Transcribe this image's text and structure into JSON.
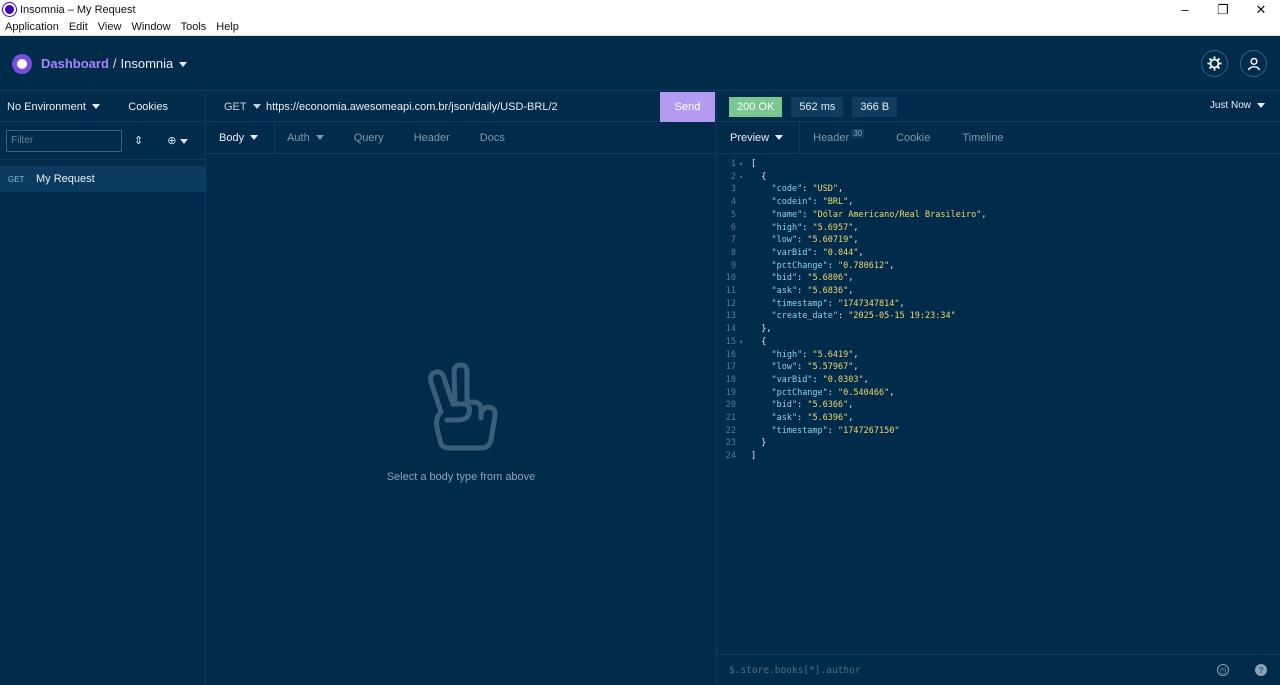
{
  "window": {
    "title": "Insomnia – My Request",
    "min": "–",
    "max": "❐",
    "close": "✕"
  },
  "menu": [
    "Application",
    "Edit",
    "View",
    "Window",
    "Tools",
    "Help"
  ],
  "header": {
    "dashboard": "Dashboard",
    "separator": "/",
    "workspace": "Insomnia",
    "settings_icon": "gear-icon",
    "account_icon": "user-icon"
  },
  "sidebar": {
    "environment": "No Environment",
    "cookies": "Cookies",
    "filter_placeholder": "Filter",
    "requests": [
      {
        "method": "GET",
        "name": "My Request"
      }
    ]
  },
  "request": {
    "method": "GET",
    "url": "https://economia.awesomeapi.com.br/json/daily/USD-BRL/2",
    "send": "Send",
    "tabs": [
      "Body",
      "Auth",
      "Query",
      "Header",
      "Docs"
    ],
    "empty_text": "Select a body type from above"
  },
  "response": {
    "status": "200 OK",
    "time": "562 ms",
    "size": "366 B",
    "when": "Just Now",
    "tabs": {
      "preview": "Preview",
      "header": "Header",
      "header_count": "30",
      "cookie": "Cookie",
      "timeline": "Timeline"
    },
    "status_color": "#7bc792",
    "lines": [
      {
        "n": "1",
        "fold": "▾",
        "indent": "",
        "text": "["
      },
      {
        "n": "2",
        "fold": "▾",
        "indent": "  ",
        "text": "{"
      },
      {
        "n": "3",
        "fold": "",
        "indent": "    ",
        "key": "\"code\"",
        "val": "\"USD\"",
        "end": ","
      },
      {
        "n": "4",
        "fold": "",
        "indent": "    ",
        "key": "\"codein\"",
        "val": "\"BRL\"",
        "end": ","
      },
      {
        "n": "5",
        "fold": "",
        "indent": "    ",
        "key": "\"name\"",
        "val": "\"Dólar Americano/Real Brasileiro\"",
        "end": ","
      },
      {
        "n": "6",
        "fold": "",
        "indent": "    ",
        "key": "\"high\"",
        "val": "\"5.6957\"",
        "end": ","
      },
      {
        "n": "7",
        "fold": "",
        "indent": "    ",
        "key": "\"low\"",
        "val": "\"5.60719\"",
        "end": ","
      },
      {
        "n": "8",
        "fold": "",
        "indent": "    ",
        "key": "\"varBid\"",
        "val": "\"0.044\"",
        "end": ","
      },
      {
        "n": "9",
        "fold": "",
        "indent": "    ",
        "key": "\"pctChange\"",
        "val": "\"0.780612\"",
        "end": ","
      },
      {
        "n": "10",
        "fold": "",
        "indent": "    ",
        "key": "\"bid\"",
        "val": "\"5.6806\"",
        "end": ","
      },
      {
        "n": "11",
        "fold": "",
        "indent": "    ",
        "key": "\"ask\"",
        "val": "\"5.6836\"",
        "end": ","
      },
      {
        "n": "12",
        "fold": "",
        "indent": "    ",
        "key": "\"timestamp\"",
        "val": "\"1747347814\"",
        "end": ","
      },
      {
        "n": "13",
        "fold": "",
        "indent": "    ",
        "key": "\"create_date\"",
        "val": "\"2025-05-15 19:23:34\"",
        "end": ""
      },
      {
        "n": "14",
        "fold": "",
        "indent": "  ",
        "text": "},"
      },
      {
        "n": "15",
        "fold": "▾",
        "indent": "  ",
        "text": "{"
      },
      {
        "n": "16",
        "fold": "",
        "indent": "    ",
        "key": "\"high\"",
        "val": "\"5.6419\"",
        "end": ","
      },
      {
        "n": "17",
        "fold": "",
        "indent": "    ",
        "key": "\"low\"",
        "val": "\"5.57967\"",
        "end": ","
      },
      {
        "n": "18",
        "fold": "",
        "indent": "    ",
        "key": "\"varBid\"",
        "val": "\"0.0303\"",
        "end": ","
      },
      {
        "n": "19",
        "fold": "",
        "indent": "    ",
        "key": "\"pctChange\"",
        "val": "\"0.540466\"",
        "end": ","
      },
      {
        "n": "20",
        "fold": "",
        "indent": "    ",
        "key": "\"bid\"",
        "val": "\"5.6366\"",
        "end": ","
      },
      {
        "n": "21",
        "fold": "",
        "indent": "    ",
        "key": "\"ask\"",
        "val": "\"5.6396\"",
        "end": ","
      },
      {
        "n": "22",
        "fold": "",
        "indent": "    ",
        "key": "\"timestamp\"",
        "val": "\"1747267150\"",
        "end": ""
      },
      {
        "n": "23",
        "fold": "",
        "indent": "  ",
        "text": "}"
      },
      {
        "n": "24",
        "fold": "",
        "indent": "",
        "text": "]"
      }
    ],
    "filter_placeholder": "$.store.books[*].author",
    "help_icon": "?",
    "clock_icon": "⏱"
  },
  "colors": {
    "background": "#002b4a",
    "accent": "#a985ff",
    "send": "#b49bf2",
    "string": "#f1d86a",
    "key": "#8fd4e3"
  }
}
